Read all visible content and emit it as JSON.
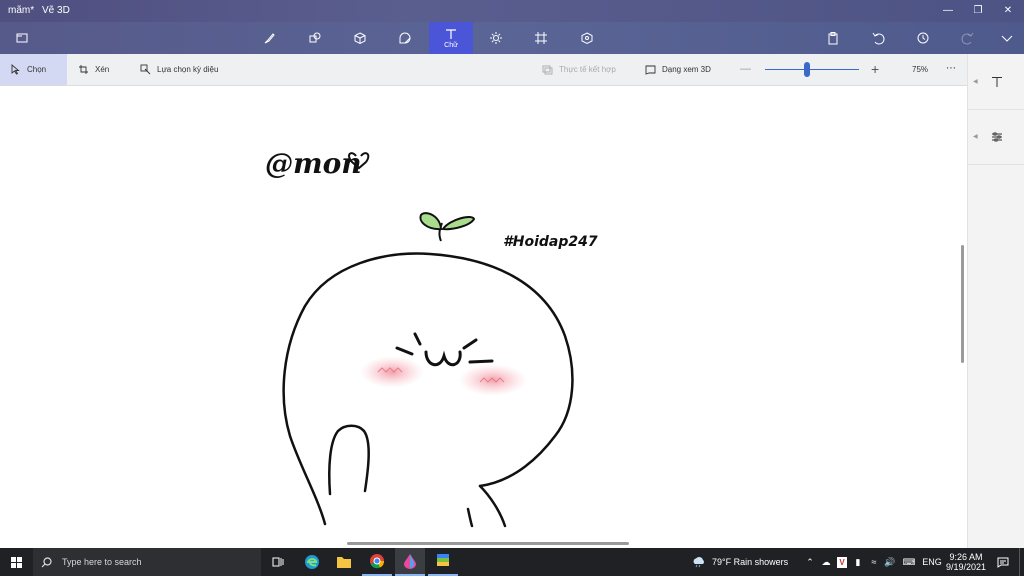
{
  "window": {
    "doc_name": "mãm*",
    "app_name": "Vẽ 3D"
  },
  "ribbon": {
    "tools": [
      {
        "name": "brushes-tab",
        "icon": "brush-icon"
      },
      {
        "name": "2d-shapes-tab",
        "icon": "shapes-icon"
      },
      {
        "name": "3d-shapes-tab",
        "icon": "cube-icon"
      },
      {
        "name": "stickers-tab",
        "icon": "sticker-icon"
      },
      {
        "name": "text-tab",
        "icon": "text-icon",
        "label": "Chữ",
        "active": true
      },
      {
        "name": "effects-tab",
        "icon": "effects-icon"
      },
      {
        "name": "canvas-tab",
        "icon": "canvas-icon"
      },
      {
        "name": "3d-library-tab",
        "icon": "library-icon"
      }
    ]
  },
  "toolbar": {
    "select_label": "Chọn",
    "crop_label": "Xén",
    "magic_select_label": "Lựa chọn kỳ diệu",
    "mixed_reality_label": "Thực tế kết hợp",
    "view3d_label": "Dạng xem 3D",
    "zoom_value": "75%",
    "zoom_level": 0.45
  },
  "canvas": {
    "watermark1": "@mon",
    "watermark2": "#Hoidap247"
  },
  "taskbar": {
    "search_placeholder": "Type here to search",
    "weather": "79°F  Rain showers",
    "language": "ENG",
    "time": "9:26 AM",
    "date": "9/19/2021"
  }
}
